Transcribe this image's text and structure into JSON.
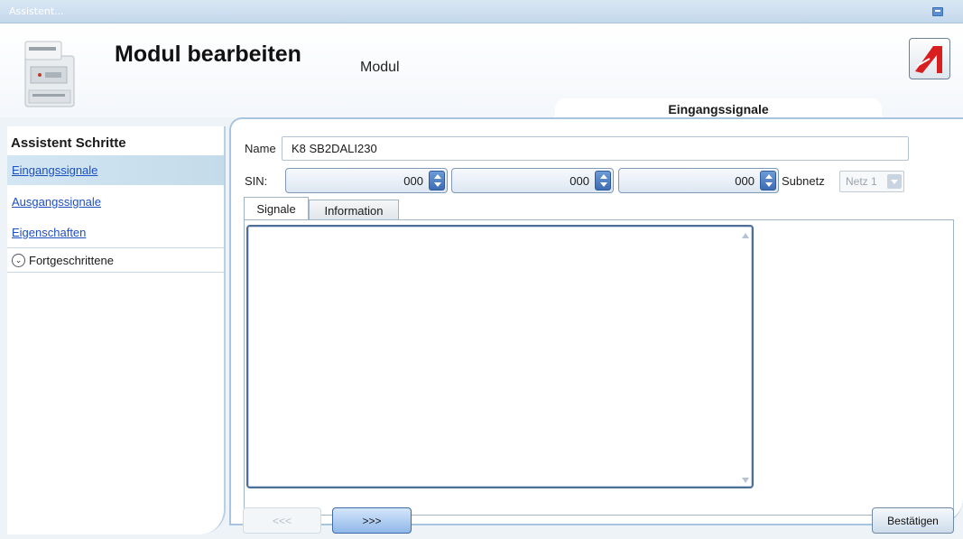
{
  "window": {
    "title": "Assistent..."
  },
  "header": {
    "title": "Modul bearbeiten",
    "subtitle": "Modul",
    "section_tab": "Eingangssignale"
  },
  "sidebar": {
    "heading": "Assistent Schritte",
    "items": [
      {
        "label": "Eingangssignale",
        "active": true
      },
      {
        "label": "Ausgangssignale"
      },
      {
        "label": "Eigenschaften"
      }
    ],
    "advanced": "Fortgeschrittene"
  },
  "form": {
    "name_label": "Name",
    "name_value": "K8 SB2DALI230",
    "sin_label": "SIN:",
    "sin_values": [
      "000",
      "000",
      "000"
    ],
    "subnet_label": "Subnetz",
    "subnet_value": "Netz 1"
  },
  "tabs": [
    "Signale",
    "Information"
  ],
  "footer": {
    "back": "<<<",
    "next": ">>>",
    "confirm": "Bestätigen"
  },
  "colors": {
    "accent": "#3d6cb3",
    "link": "#1c4fc2",
    "border": "#a9c4de"
  }
}
